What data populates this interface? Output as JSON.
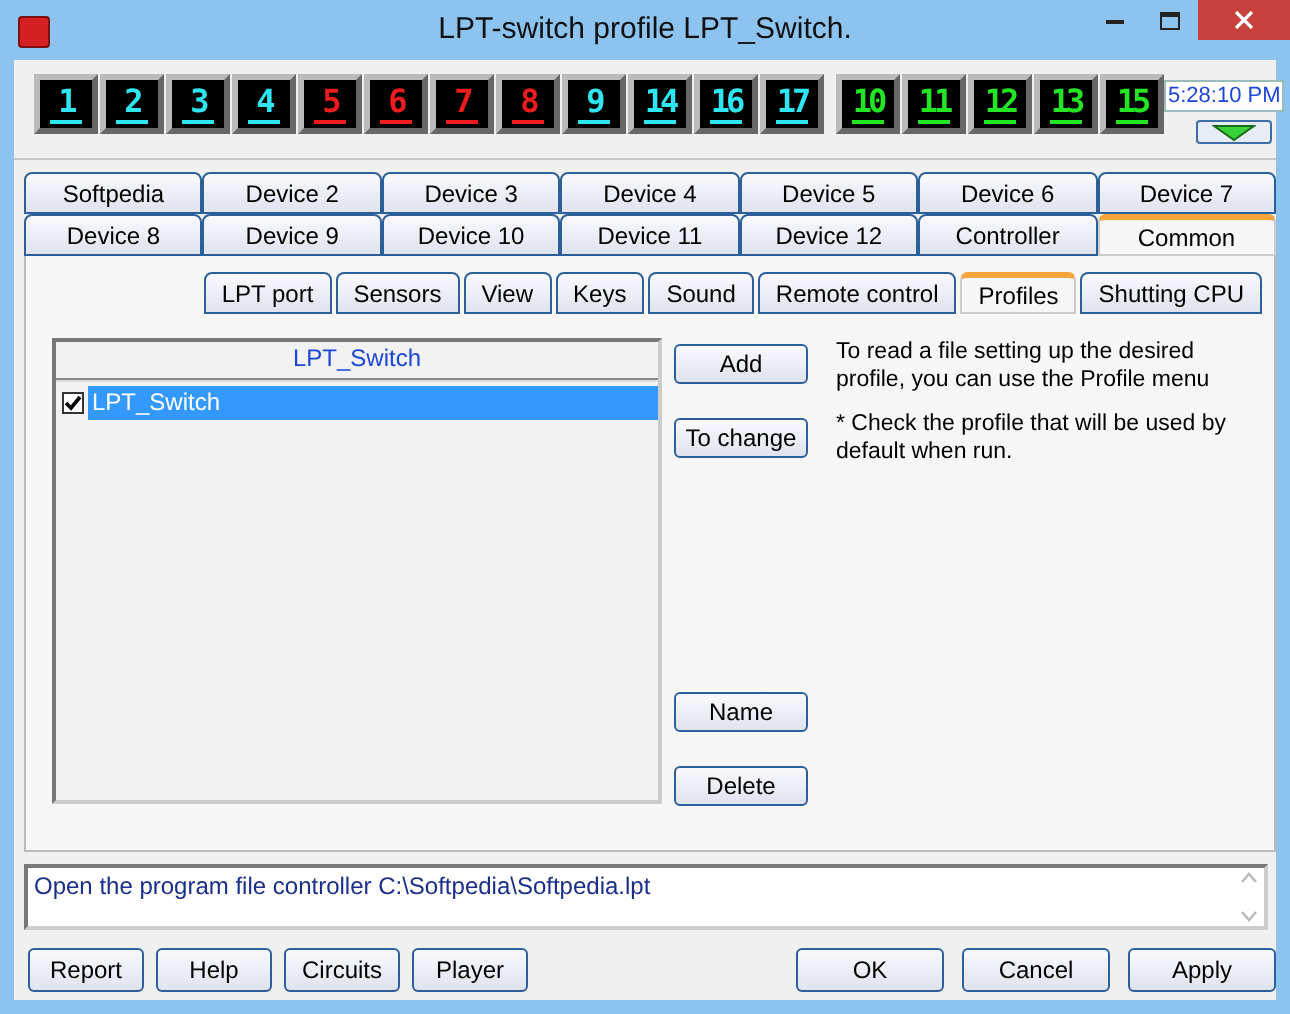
{
  "window": {
    "title": "LPT-switch profile LPT_Switch."
  },
  "indicator_groups": [
    {
      "items": [
        {
          "label": "1",
          "color": "#2ee6f2"
        },
        {
          "label": "2",
          "color": "#2ee6f2"
        },
        {
          "label": "3",
          "color": "#2ee6f2"
        },
        {
          "label": "4",
          "color": "#2ee6f2"
        },
        {
          "label": "5",
          "color": "#ee1c1c"
        },
        {
          "label": "6",
          "color": "#ee1c1c"
        },
        {
          "label": "7",
          "color": "#ee1c1c"
        },
        {
          "label": "8",
          "color": "#ee1c1c"
        },
        {
          "label": "9",
          "color": "#2ee6f2"
        },
        {
          "label": "14",
          "color": "#2ee6f2"
        },
        {
          "label": "16",
          "color": "#2ee6f2"
        },
        {
          "label": "17",
          "color": "#2ee6f2"
        }
      ]
    },
    {
      "items": [
        {
          "label": "10",
          "color": "#22e622"
        },
        {
          "label": "11",
          "color": "#22e622"
        },
        {
          "label": "12",
          "color": "#22e622"
        },
        {
          "label": "13",
          "color": "#22e622"
        },
        {
          "label": "15",
          "color": "#22e622"
        }
      ]
    }
  ],
  "clock": "5:28:10 PM",
  "device_tab_rows": [
    {
      "tabs": [
        {
          "label": "Softpedia",
          "selected": false
        },
        {
          "label": "Device 2",
          "selected": false
        },
        {
          "label": "Device 3",
          "selected": false
        },
        {
          "label": "Device 4",
          "selected": false
        },
        {
          "label": "Device 5",
          "selected": false
        },
        {
          "label": "Device 6",
          "selected": false
        },
        {
          "label": "Device 7",
          "selected": false
        }
      ]
    },
    {
      "tabs": [
        {
          "label": "Device 8",
          "selected": false
        },
        {
          "label": "Device 9",
          "selected": false
        },
        {
          "label": "Device 10",
          "selected": false
        },
        {
          "label": "Device 11",
          "selected": false
        },
        {
          "label": "Device 12",
          "selected": false
        },
        {
          "label": "Controller",
          "selected": false
        },
        {
          "label": "Common",
          "selected": true
        }
      ]
    }
  ],
  "sub_tabs": [
    {
      "label": "LPT port",
      "selected": false
    },
    {
      "label": "Sensors",
      "selected": false
    },
    {
      "label": "View",
      "selected": false
    },
    {
      "label": "Keys",
      "selected": false
    },
    {
      "label": "Sound",
      "selected": false
    },
    {
      "label": "Remote control",
      "selected": false
    },
    {
      "label": "Profiles",
      "selected": true
    },
    {
      "label": "Shutting CPU",
      "selected": false
    }
  ],
  "profile_list": {
    "header": "LPT_Switch",
    "items": [
      {
        "label": "LPT_Switch",
        "checked": true,
        "selected": true
      }
    ]
  },
  "side_buttons_top": [
    "Add",
    "To change"
  ],
  "side_buttons_bottom": [
    "Name",
    "Delete"
  ],
  "hints": [
    "To read a file setting up the desired profile, you can use the Profile menu",
    "* Check the profile that will be used by default when run."
  ],
  "message": "Open the program file controller C:\\Softpedia\\Softpedia.lpt",
  "bottom_buttons_left": [
    "Report",
    "Help",
    "Circuits",
    "Player"
  ],
  "bottom_buttons_right": [
    "OK",
    "Cancel",
    "Apply"
  ]
}
